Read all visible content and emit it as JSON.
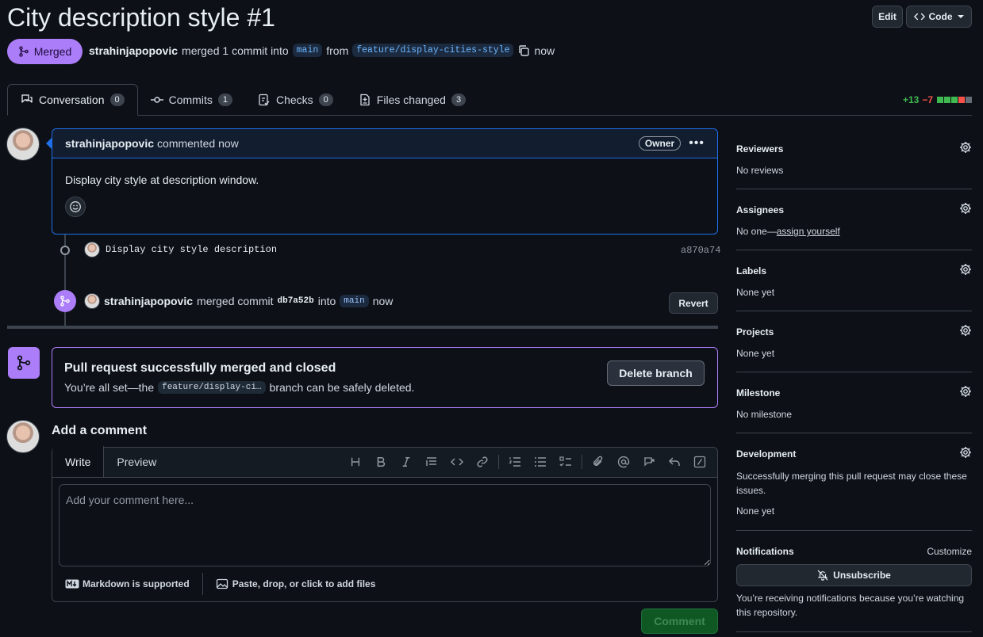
{
  "header": {
    "title": "City description style #1",
    "edit_label": "Edit",
    "code_label": "Code",
    "status": "Merged",
    "author": "strahinjapopovic",
    "merge_text": "merged 1 commit into",
    "base_branch": "main",
    "from_text": "from",
    "head_branch": "feature/display-cities-style",
    "time": "now"
  },
  "tabs": [
    {
      "label": "Conversation",
      "count": "0"
    },
    {
      "label": "Commits",
      "count": "1"
    },
    {
      "label": "Checks",
      "count": "0"
    },
    {
      "label": "Files changed",
      "count": "3"
    }
  ],
  "diffstat": {
    "additions": "+13",
    "deletions": "−7"
  },
  "comment": {
    "author": "strahinjapopovic",
    "action": "commented now",
    "role": "Owner",
    "body": "Display city style at description window."
  },
  "timeline": {
    "commit_message": "Display city style description",
    "commit_sha": "a870a74",
    "merge_author": "strahinjapopovic",
    "merge_text": "merged commit",
    "merge_sha": "db7a52b",
    "into_text": "into",
    "merge_branch": "main",
    "merge_time": "now",
    "revert_label": "Revert"
  },
  "merged_box": {
    "title": "Pull request successfully merged and closed",
    "sub_prefix": "You’re all set—the",
    "branch": "feature/display-ci…",
    "sub_suffix": "branch can be safely deleted.",
    "delete_label": "Delete branch"
  },
  "add_comment": {
    "title": "Add a comment",
    "write_tab": "Write",
    "preview_tab": "Preview",
    "placeholder": "Add your comment here...",
    "markdown_note": "Markdown is supported",
    "attach_note": "Paste, drop, or click to add files",
    "submit_label": "Comment"
  },
  "sidebar": {
    "reviewers": {
      "label": "Reviewers",
      "value": "No reviews"
    },
    "assignees": {
      "label": "Assignees",
      "value_prefix": "No one—",
      "link": "assign yourself"
    },
    "labels": {
      "label": "Labels",
      "value": "None yet"
    },
    "projects": {
      "label": "Projects",
      "value": "None yet"
    },
    "milestone": {
      "label": "Milestone",
      "value": "No milestone"
    },
    "development": {
      "label": "Development",
      "note": "Successfully merging this pull request may close these issues.",
      "value": "None yet"
    },
    "notifications": {
      "label": "Notifications",
      "customize": "Customize",
      "unsubscribe": "Unsubscribe",
      "note": "You’re receiving notifications because you’re watching this repository."
    }
  },
  "colors": {
    "merged_purple": "#ab7df8",
    "accent_blue": "#1f6feb",
    "add_green": "#3fb950",
    "del_red": "#f85149",
    "bg": "#0d1117"
  }
}
